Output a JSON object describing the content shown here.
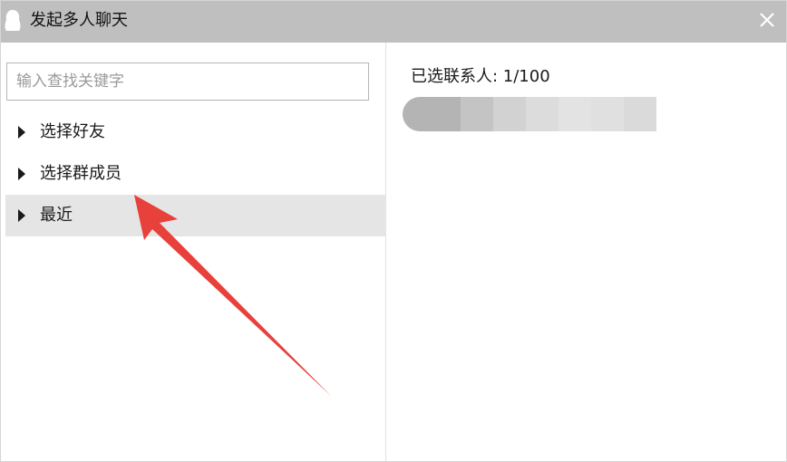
{
  "window": {
    "title": "发起多人聊天",
    "app_icon": "penguin-icon",
    "close_icon": "close-icon"
  },
  "search": {
    "placeholder": "输入查找关键字",
    "value": ""
  },
  "tree": {
    "items": [
      {
        "label": "选择好友",
        "selected": false
      },
      {
        "label": "选择群成员",
        "selected": false
      },
      {
        "label": "最近",
        "selected": true
      }
    ]
  },
  "selected": {
    "count_text": "已选联系人: 1/100",
    "contacts_blurred": 1
  },
  "annotation": {
    "arrow_color": "#e8413c"
  },
  "colors": {
    "titlebar": "#bfbfbf",
    "selected_row": "#e5e5e5"
  }
}
